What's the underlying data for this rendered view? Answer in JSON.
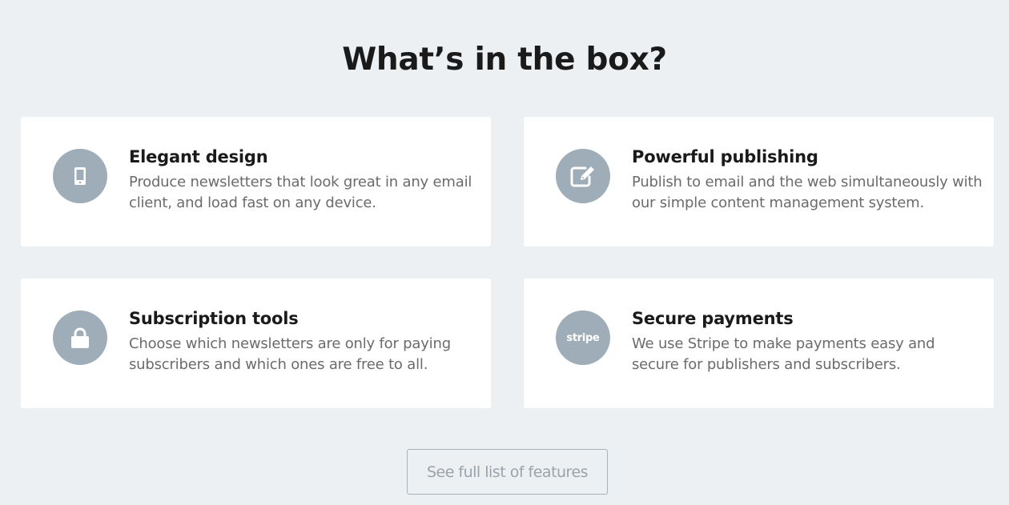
{
  "section": {
    "title": "What’s in the box?"
  },
  "features": [
    {
      "icon": "mobile-phone-icon",
      "title": "Elegant design",
      "description": "Produce newsletters that look great in any email client, and load fast on any device."
    },
    {
      "icon": "edit-icon",
      "title": "Powerful publishing",
      "description": "Publish to email and the web simultaneously with our simple content management system."
    },
    {
      "icon": "lock-icon",
      "title": "Subscription tools",
      "description": "Choose which newsletters are only for paying subscribers and which ones are free to all."
    },
    {
      "icon": "stripe-logo-icon",
      "icon_text": "stripe",
      "title": "Secure payments",
      "description": "We use Stripe to make payments easy and secure for publishers and subscribers."
    }
  ],
  "cta": {
    "label": "See full list of features"
  },
  "colors": {
    "background": "#edf0f3",
    "card": "#ffffff",
    "icon_circle": "#9eadb7",
    "heading": "#1a1a1a",
    "body_text": "#6b6b6b",
    "button_border": "#a9b2b9",
    "button_text": "#9aa3a9"
  }
}
